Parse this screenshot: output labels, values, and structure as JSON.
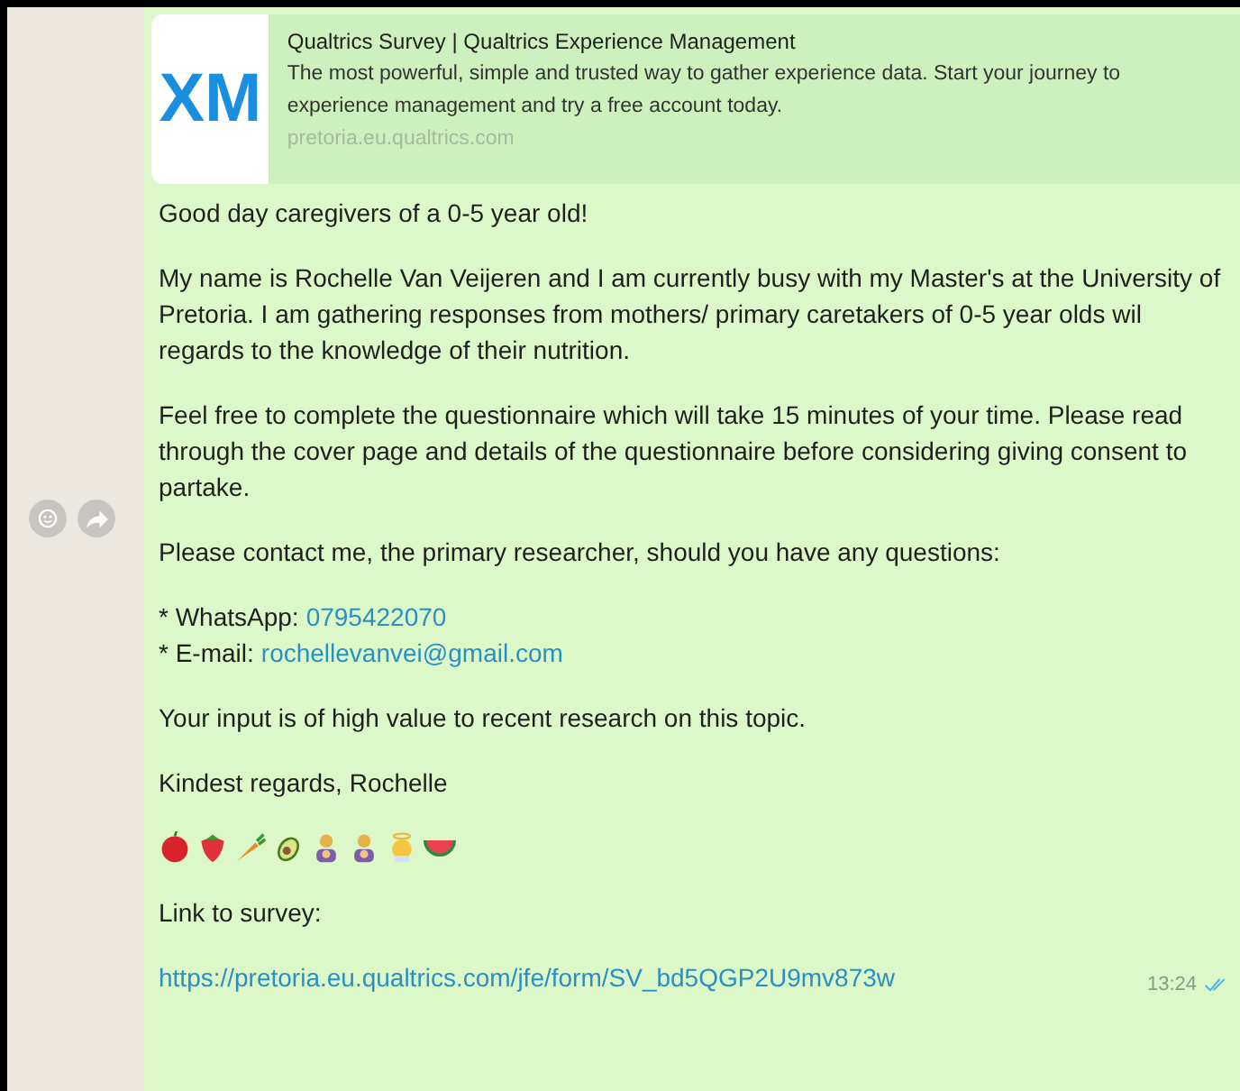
{
  "link_preview": {
    "logo": "XM",
    "title": "Qualtrics Survey | Qualtrics Experience Management",
    "description": "The most powerful, simple and trusted way to gather experience data. Start your journey to experience management and try a free account today.",
    "domain": "pretoria.eu.qualtrics.com"
  },
  "message": {
    "paragraphs": [
      {
        "kind": "text",
        "text": "Good day caregivers of a 0-5 year old!"
      },
      {
        "kind": "text",
        "text": "My name is Rochelle Van Veijeren and I am currently busy with my Master's at the University of Pretoria. I am gathering responses from mothers/ primary caretakers of 0-5 year olds wil regards to the knowledge of their nutrition."
      },
      {
        "kind": "text",
        "text": "Feel free to complete the questionnaire which will take 15 minutes of your time. Please read through the cover page and details of the questionnaire before considering giving consent to partake."
      },
      {
        "kind": "text",
        "text": "Please contact me, the primary researcher, should you have any questions:"
      },
      {
        "kind": "contacts",
        "items": [
          {
            "label": "* WhatsApp:",
            "link": "0795422070"
          },
          {
            "label": "* E-mail:",
            "link": "rochellevanvei@gmail.com"
          }
        ]
      },
      {
        "kind": "text",
        "text": "Your input is of high value to recent research on this topic."
      },
      {
        "kind": "text",
        "text": "Kindest regards, Rochelle"
      },
      {
        "kind": "emoji"
      },
      {
        "kind": "text",
        "text": "Link to survey:"
      },
      {
        "kind": "link",
        "text": "https://pretoria.eu.qualtrics.com/jfe/form/SV_bd5QGP2U9mv873w"
      }
    ],
    "time": "13:24",
    "read": true
  }
}
